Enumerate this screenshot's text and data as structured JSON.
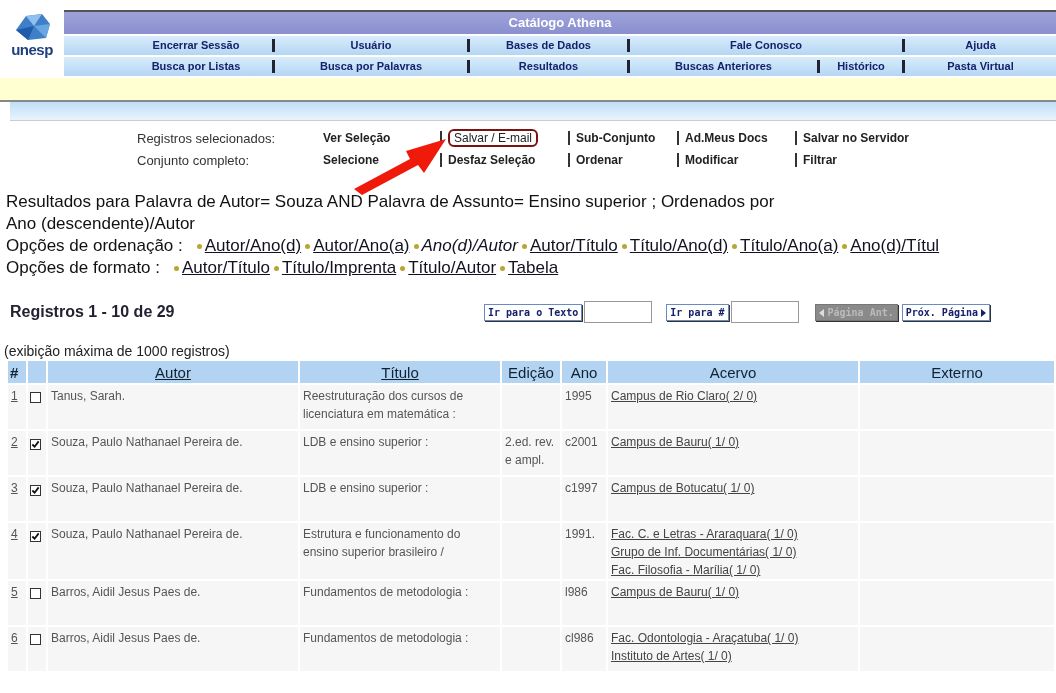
{
  "header": {
    "logo_text": "unesp",
    "title": "Catálogo Athena",
    "menu_rows": [
      [
        {
          "label": "Encerrar Sessão"
        },
        {
          "label": "Usuário"
        },
        {
          "label": "Bases de Dados"
        },
        {
          "label": "Fale Conosco"
        },
        {
          "label": "Ajuda"
        }
      ],
      [
        {
          "label": "Busca por Listas"
        },
        {
          "label": "Busca por Palavras"
        },
        {
          "label": "Resultados"
        },
        {
          "label": "Buscas Anteriores"
        },
        {
          "label": "Histórico"
        },
        {
          "label": "Pasta Virtual"
        }
      ]
    ]
  },
  "actions": [
    {
      "label": "Registros selecionados:",
      "links": [
        {
          "label": "Ver Seleção",
          "highlighted": false
        },
        {
          "label": "Salvar / E-mail",
          "highlighted": true
        },
        {
          "label": "Sub-Conjunto",
          "highlighted": false
        },
        {
          "label": "Ad.Meus Docs",
          "highlighted": false
        },
        {
          "label": "Salvar no Servidor",
          "highlighted": false
        }
      ]
    },
    {
      "label": "Conjunto completo:",
      "links": [
        {
          "label": "Selecione",
          "highlighted": false
        },
        {
          "label": "Desfaz Seleção",
          "highlighted": false
        },
        {
          "label": "Ordenar",
          "highlighted": false
        },
        {
          "label": "Modificar",
          "highlighted": false
        },
        {
          "label": "Filtrar",
          "highlighted": false
        }
      ]
    }
  ],
  "results_text": "Resultados para Palavra de Autor= Souza AND Palavra de Assunto= Ensino superior ; Ordenados por Ano (descendente)/Autor",
  "sort_options": {
    "label": "Opções de ordenação :",
    "items": [
      {
        "label": "Autor/Ano(d)",
        "selected": false
      },
      {
        "label": "Autor/Ano(a)",
        "selected": false
      },
      {
        "label": "Ano(d)/Autor",
        "selected": true
      },
      {
        "label": "Autor/Título",
        "selected": false
      },
      {
        "label": "Título/Ano(d)",
        "selected": false
      },
      {
        "label": "Título/Ano(a)",
        "selected": false
      },
      {
        "label": "Ano(d)/Títul",
        "selected": false
      }
    ]
  },
  "format_options": {
    "label": "Opções de formato :",
    "items": [
      {
        "label": "Autor/Título"
      },
      {
        "label": "Título/Imprenta"
      },
      {
        "label": "Título/Autor"
      },
      {
        "label": "Tabela"
      }
    ]
  },
  "records_count": "Registros 1 - 10 de 29",
  "pager": [
    {
      "kind": "goto",
      "label": "Ir para o Texto"
    },
    {
      "kind": "goto",
      "label": "Ir para #"
    },
    {
      "kind": "prev",
      "label": "Página Ant.",
      "disabled": true
    },
    {
      "kind": "next",
      "label": "Próx. Página",
      "disabled": false
    }
  ],
  "max_note": "(exibição máxima de 1000 registros)",
  "table": {
    "columns": [
      "#",
      "Autor",
      "Título",
      "Edição",
      "Ano",
      "Acervo",
      "Externo"
    ],
    "rows": [
      {
        "number": "1",
        "checked": false,
        "autor": "Tanus, Sarah.",
        "titulo": "Reestruturação dos cursos de licenciatura em matemática :",
        "edicao": "",
        "ano": "1995",
        "acervo": [
          "Campus de Rio Claro( 2/ 0)"
        ]
      },
      {
        "number": "2",
        "checked": true,
        "autor": "Souza, Paulo Nathanael Pereira de.",
        "titulo": "LDB e ensino superior :",
        "edicao": "2.ed. rev. e ampl.",
        "ano": "c2001",
        "acervo": [
          "Campus de Bauru( 1/ 0)"
        ]
      },
      {
        "number": "3",
        "checked": true,
        "autor": "Souza, Paulo Nathanael Pereira de.",
        "titulo": "LDB e ensino superior :",
        "edicao": "",
        "ano": "c1997",
        "acervo": [
          "Campus de Botucatu( 1/ 0)"
        ]
      },
      {
        "number": "4",
        "checked": true,
        "autor": "Souza, Paulo Nathanael Pereira de.",
        "titulo": "Estrutura e funcionamento do ensino superior brasileiro /",
        "edicao": "",
        "ano": "1991.",
        "acervo": [
          "Fac. C. e Letras - Araraquara( 1/ 0)",
          "Grupo de Inf. Documentárias( 1/ 0)",
          "Fac. Filosofia - Marília( 1/ 0)"
        ]
      },
      {
        "number": "5",
        "checked": false,
        "autor": "Barros, Aidil Jesus Paes de.",
        "titulo": "Fundamentos de metodologia :",
        "edicao": "",
        "ano": "l986",
        "acervo": [
          "Campus de Bauru( 1/ 0)"
        ]
      },
      {
        "number": "6",
        "checked": false,
        "autor": "Barros, Aidil Jesus Paes de.",
        "titulo": "Fundamentos de metodologia :",
        "edicao": "",
        "ano": "cl986",
        "acervo": [
          "Fac. Odontologia - Araçatuba( 1/ 0)",
          "Instituto de Artes( 1/ 0)"
        ]
      }
    ]
  }
}
